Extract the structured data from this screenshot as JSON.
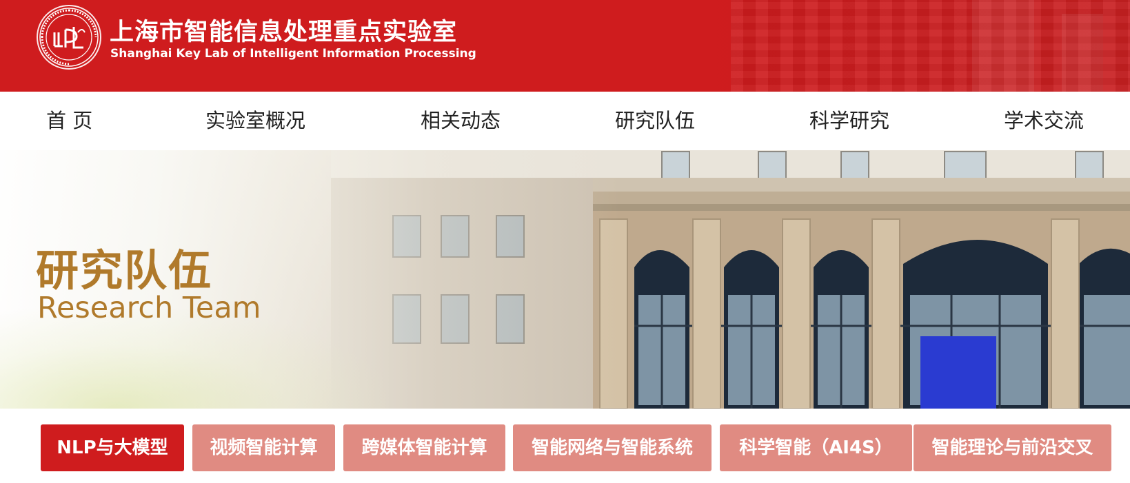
{
  "header": {
    "title_cn": "上海市智能信息处理重点实验室",
    "title_en": "Shanghai Key Lab of Intelligent Information Processing",
    "brand_color": "#cf1c1e"
  },
  "nav": {
    "items": [
      {
        "label": "首 页"
      },
      {
        "label": "实验室概况"
      },
      {
        "label": "相关动态"
      },
      {
        "label": "研究队伍"
      },
      {
        "label": "科学研究"
      },
      {
        "label": "学术交流"
      }
    ]
  },
  "banner": {
    "title_cn": "研究队伍",
    "title_en": "Research Team",
    "accent_color": "#b07a2b"
  },
  "tabs": {
    "active_index": 0,
    "active_color": "#cf1c1e",
    "inactive_color": "#e08b82",
    "items": [
      {
        "label": "NLP与大模型"
      },
      {
        "label": "视频智能计算"
      },
      {
        "label": "跨媒体智能计算"
      },
      {
        "label": "智能网络与智能系统"
      },
      {
        "label": "科学智能（AI4S）"
      },
      {
        "label": "智能理论与前沿交叉"
      }
    ]
  },
  "icons": {
    "logo": "lab-seal-icon"
  }
}
